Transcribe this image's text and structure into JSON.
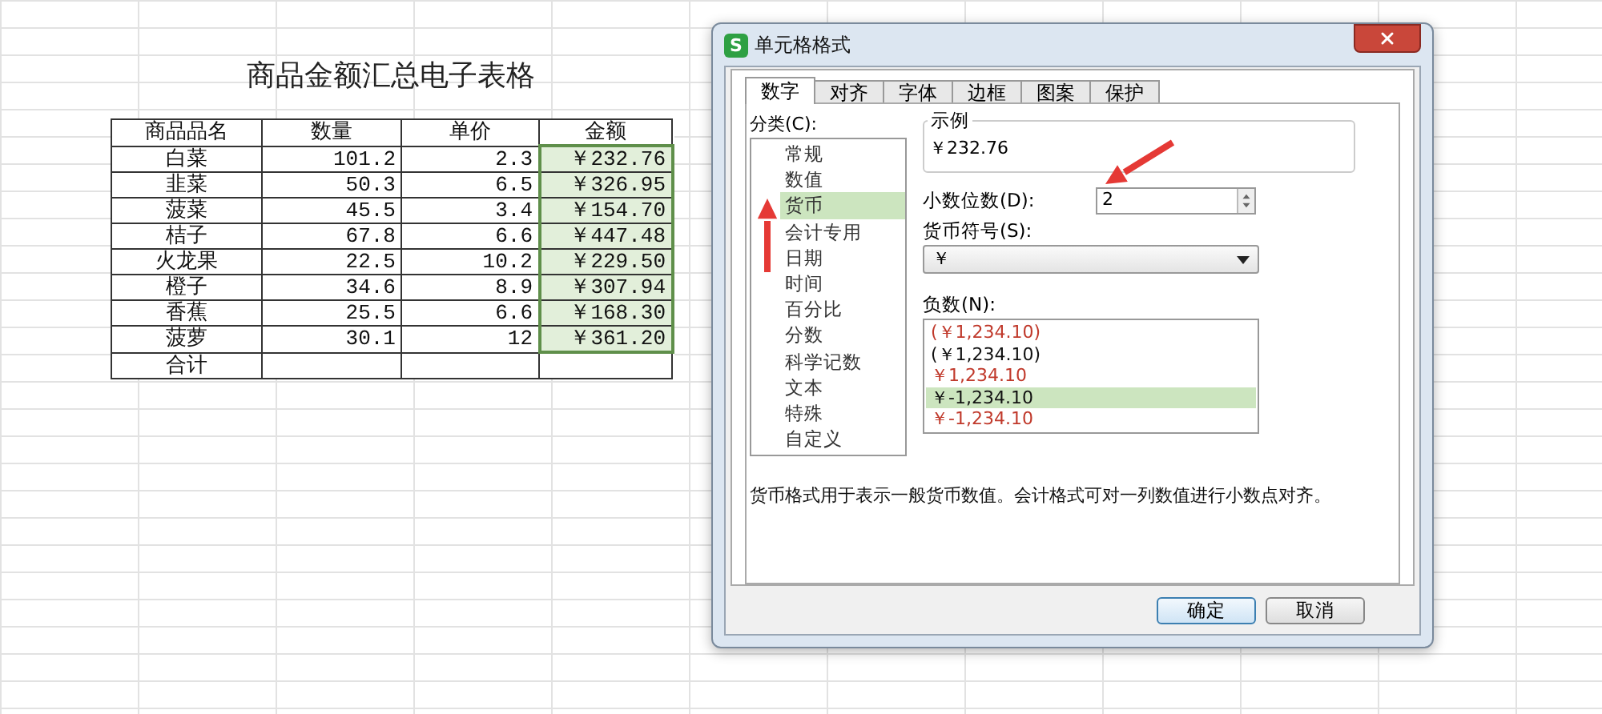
{
  "sheet": {
    "title": "商品金额汇总电子表格",
    "columns": [
      "商品品名",
      "数量",
      "单价",
      "金额"
    ],
    "rows": [
      {
        "name": "白菜",
        "qty": "101.2",
        "price": "2.3",
        "amount": "￥232.76",
        "selected": true
      },
      {
        "name": "韭菜",
        "qty": "50.3",
        "price": "6.5",
        "amount": "￥326.95",
        "selected": true
      },
      {
        "name": "菠菜",
        "qty": "45.5",
        "price": "3.4",
        "amount": "￥154.70",
        "selected": true
      },
      {
        "name": "桔子",
        "qty": "67.8",
        "price": "6.6",
        "amount": "￥447.48",
        "selected": true
      },
      {
        "name": "火龙果",
        "qty": "22.5",
        "price": "10.2",
        "amount": "￥229.50",
        "selected": true
      },
      {
        "name": "橙子",
        "qty": "34.6",
        "price": "8.9",
        "amount": "￥307.94",
        "selected": true
      },
      {
        "name": "香蕉",
        "qty": "25.5",
        "price": "6.6",
        "amount": "￥168.30",
        "selected": true
      },
      {
        "name": "菠萝",
        "qty": "30.1",
        "price": "12",
        "amount": "￥361.20",
        "selected": true
      }
    ],
    "total_label": "合计"
  },
  "dialog": {
    "logo_text": "S",
    "title": "单元格格式",
    "tabs": [
      {
        "label": "数字",
        "selected": true
      },
      {
        "label": "对齐",
        "selected": false
      },
      {
        "label": "字体",
        "selected": false
      },
      {
        "label": "边框",
        "selected": false
      },
      {
        "label": "图案",
        "selected": false
      },
      {
        "label": "保护",
        "selected": false
      }
    ],
    "category_label": "分类(C):",
    "categories": [
      {
        "label": "常规",
        "selected": false
      },
      {
        "label": "数值",
        "selected": false
      },
      {
        "label": "货币",
        "selected": true
      },
      {
        "label": "会计专用",
        "selected": false
      },
      {
        "label": "日期",
        "selected": false
      },
      {
        "label": "时间",
        "selected": false
      },
      {
        "label": "百分比",
        "selected": false
      },
      {
        "label": "分数",
        "selected": false
      },
      {
        "label": "科学记数",
        "selected": false
      },
      {
        "label": "文本",
        "selected": false
      },
      {
        "label": "特殊",
        "selected": false
      },
      {
        "label": "自定义",
        "selected": false
      }
    ],
    "sample": {
      "label": "示例",
      "value": "￥232.76"
    },
    "decimals": {
      "label": "小数位数(D):",
      "value": "2"
    },
    "currency": {
      "label": "货币符号(S):",
      "value": "￥"
    },
    "negative": {
      "label": "负数(N):",
      "items": [
        {
          "text": "(￥1,234.10)",
          "color": "#c0392b",
          "selected": false
        },
        {
          "text": "(￥1,234.10)",
          "color": "#111111",
          "selected": false
        },
        {
          "text": "￥1,234.10",
          "color": "#c0392b",
          "selected": false
        },
        {
          "text": "￥-1,234.10",
          "color": "#111111",
          "selected": true
        },
        {
          "text": "￥-1,234.10",
          "color": "#c0392b",
          "selected": false
        }
      ]
    },
    "description": "货币格式用于表示一般货币数值。会计格式可对一列数值进行小数点对齐。",
    "buttons": [
      {
        "label": "确定",
        "kind": "primary"
      },
      {
        "label": "取消",
        "kind": "secondary"
      }
    ]
  }
}
